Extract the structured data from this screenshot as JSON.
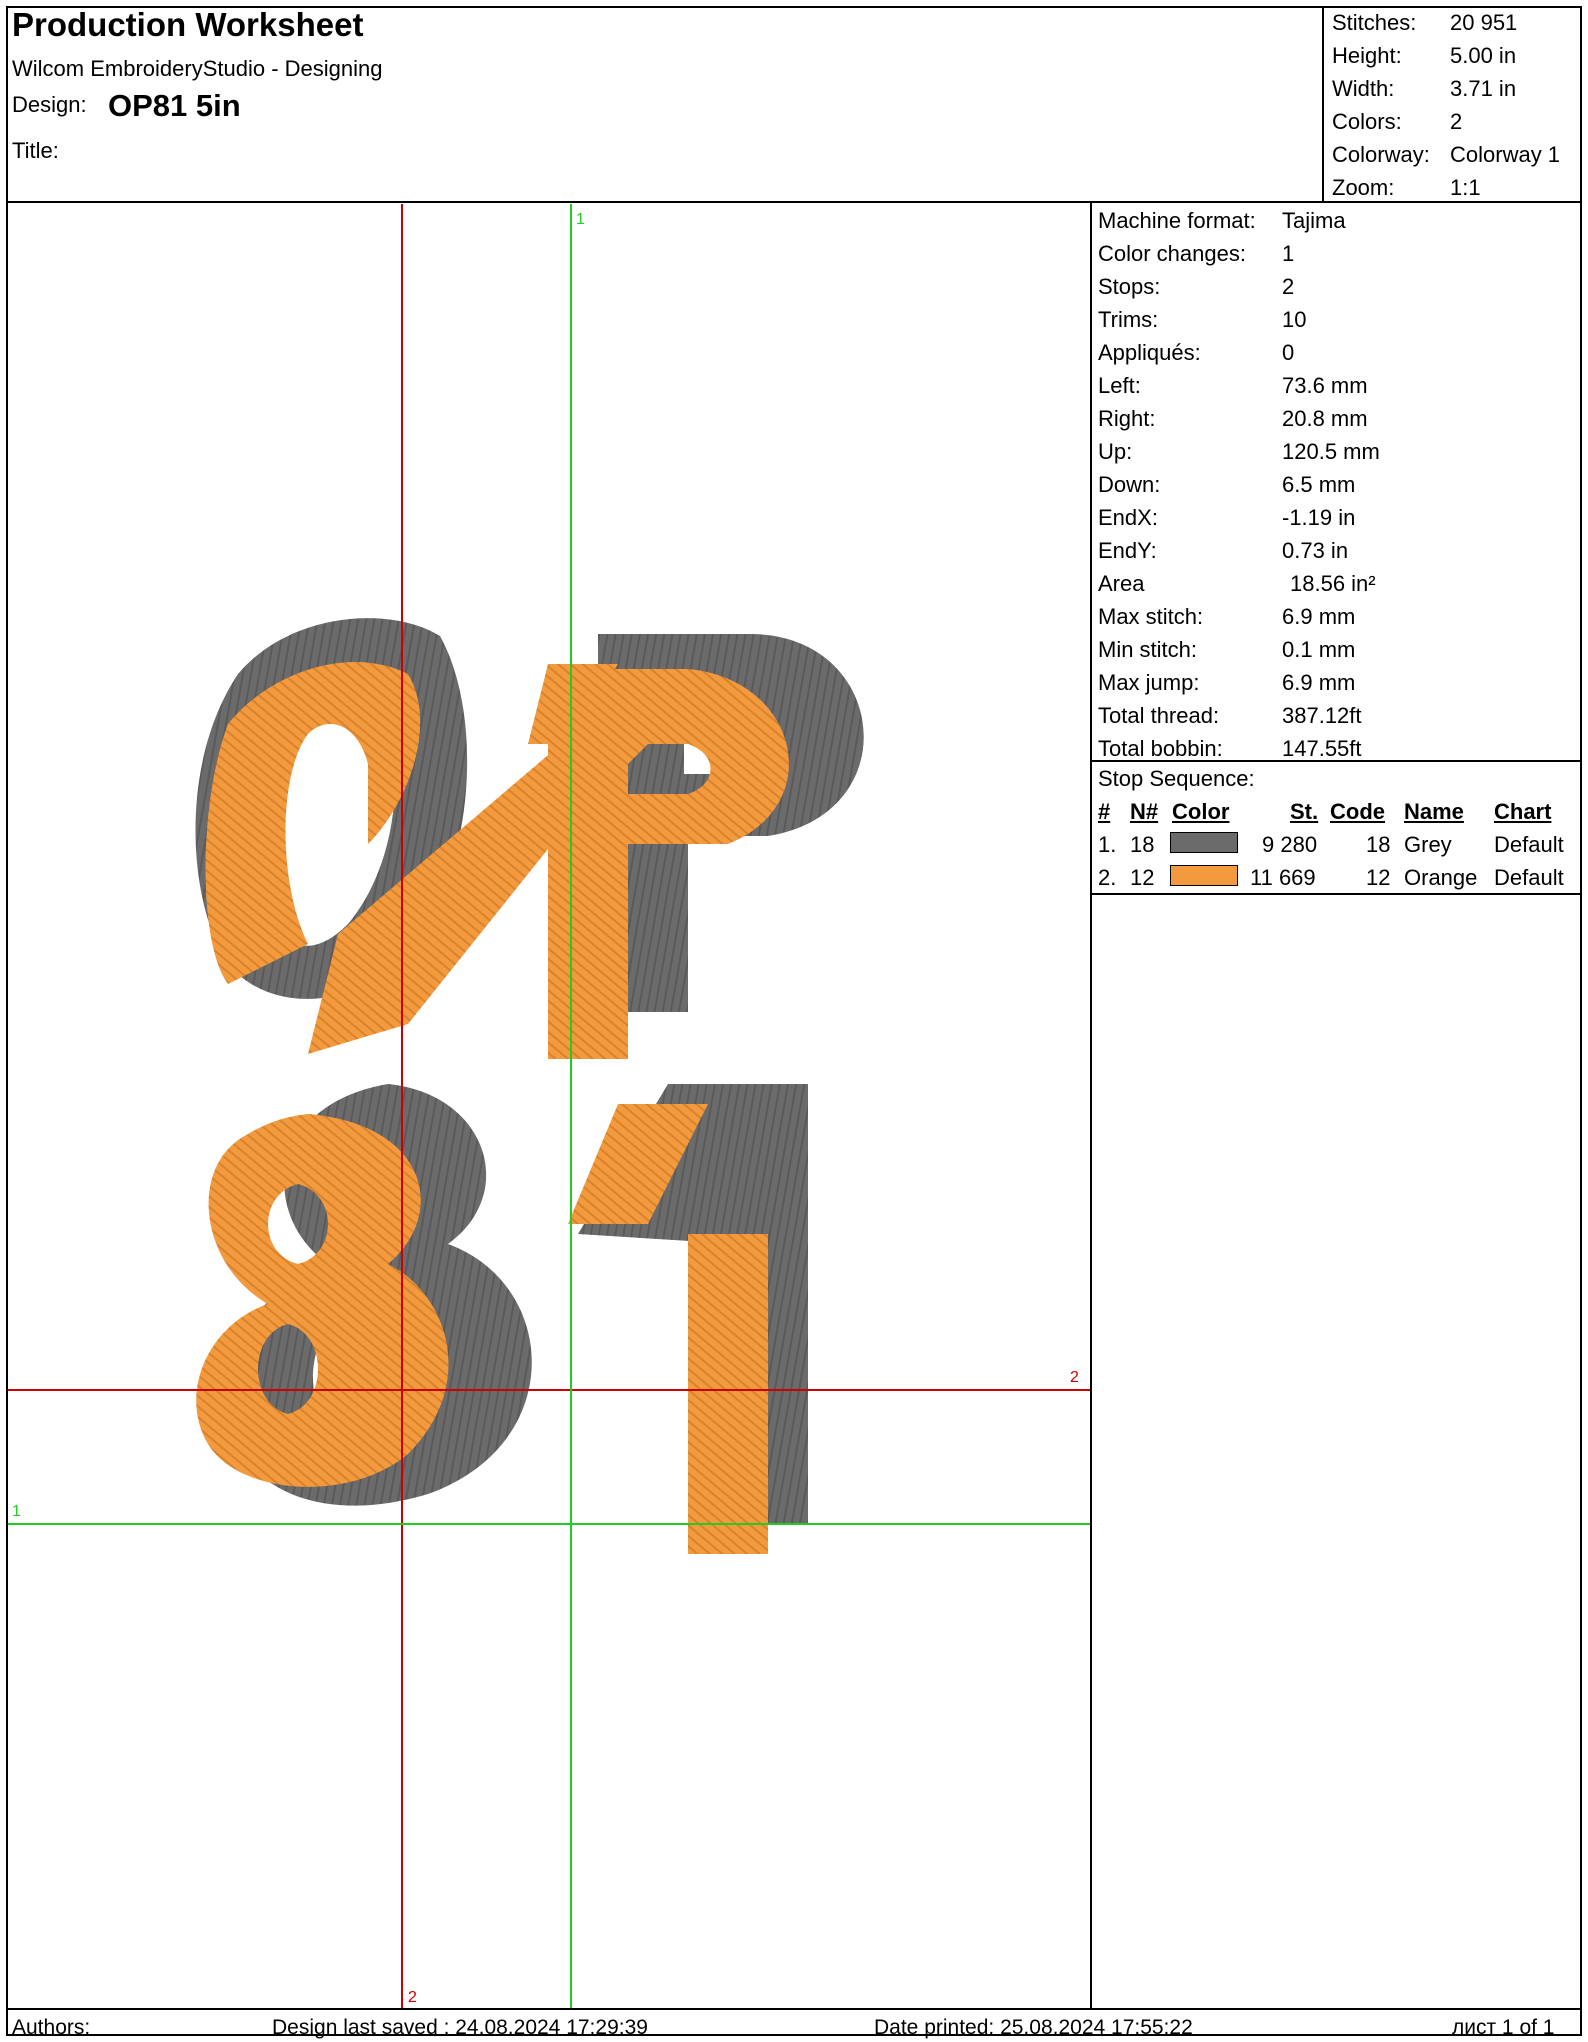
{
  "header": {
    "title": "Production Worksheet",
    "subtitle": "Wilcom EmbroideryStudio - Designing",
    "design_label": "Design:",
    "design_value": "OP81 5in",
    "title_label": "Title:"
  },
  "stats": [
    {
      "key": "Stitches:",
      "value": "20 951"
    },
    {
      "key": "Height:",
      "value": "5.00 in"
    },
    {
      "key": "Width:",
      "value": "3.71 in"
    },
    {
      "key": "Colors:",
      "value": "2"
    },
    {
      "key": "Colorway:",
      "value": "Colorway 1"
    },
    {
      "key": "Zoom:",
      "value": "1:1"
    }
  ],
  "machine": [
    {
      "key": "Machine format:",
      "value": "Tajima"
    },
    {
      "key": "Color changes:",
      "value": "1"
    },
    {
      "key": "Stops:",
      "value": "2"
    },
    {
      "key": "Trims:",
      "value": "10"
    },
    {
      "key": "Appliqués:",
      "value": "0"
    },
    {
      "key": "Left:",
      "value": "73.6 mm"
    },
    {
      "key": "Right:",
      "value": "20.8 mm"
    },
    {
      "key": "Up:",
      "value": "120.5 mm"
    },
    {
      "key": "Down:",
      "value": "6.5 mm"
    },
    {
      "key": "EndX:",
      "value": "-1.19 in"
    },
    {
      "key": "EndY:",
      "value": "0.73 in"
    },
    {
      "key": "Area",
      "value": "18.56 in²"
    },
    {
      "key": "Max stitch:",
      "value": "6.9 mm"
    },
    {
      "key": "Min stitch:",
      "value": "0.1 mm"
    },
    {
      "key": "Max jump:",
      "value": "6.9 mm"
    },
    {
      "key": "Total thread:",
      "value": "387.12ft"
    },
    {
      "key": "Total bobbin:",
      "value": "147.55ft"
    }
  ],
  "stop_sequence": {
    "title": "Stop Sequence:",
    "headers": {
      "num": "#",
      "n": "N#",
      "color": "Color",
      "st": "St.",
      "code": "Code",
      "name": "Name",
      "chart": "Chart"
    },
    "rows": [
      {
        "num": "1.",
        "n": "18",
        "color": "#6b6b6b",
        "st": "9 280",
        "code": "18",
        "name": "Grey",
        "chart": "Default"
      },
      {
        "num": "2.",
        "n": "12",
        "color": "#f39a3e",
        "st": "11 669",
        "code": "12",
        "name": "Orange",
        "chart": "Default"
      }
    ]
  },
  "canvas": {
    "markers": {
      "red_v": "2",
      "red_h": "2",
      "green_v": "1",
      "green_h": "1"
    },
    "colors": {
      "grey": "#6b6b6b",
      "orange": "#f39a3e",
      "red": "#cc0000",
      "green": "#22cc22"
    }
  },
  "footer": {
    "authors": "Authors:",
    "saved": "Design last saved : 24.08.2024 17:29:39",
    "printed": "Date printed: 25.08.2024 17:55:22",
    "page": "лист 1 of 1"
  }
}
